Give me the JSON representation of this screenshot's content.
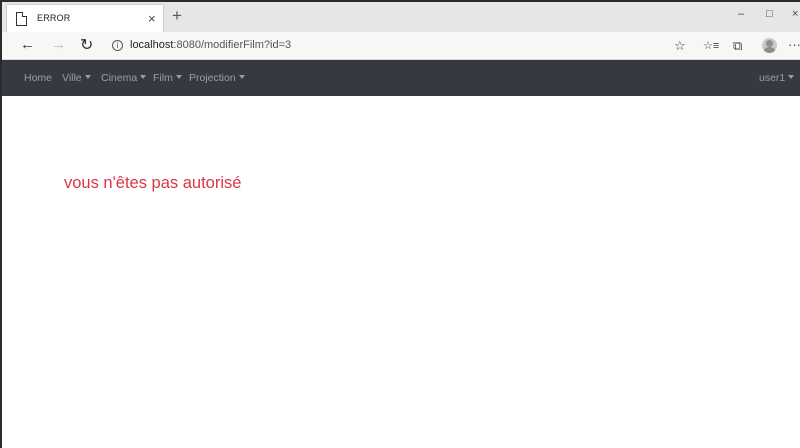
{
  "browser": {
    "tab_title": "ERROR",
    "tab_close": "×",
    "new_tab": "+",
    "back": "←",
    "forward": "→",
    "reload": "↻",
    "info": "i",
    "url_host": "localhost",
    "url_rest": ":8080/modifierFilm?id=3",
    "window_controls": {
      "minimize": "–",
      "restore": "□",
      "close": "×"
    },
    "toolbar_icons": [
      "star-icon",
      "favorites-icon",
      "collections-icon",
      "profile-icon",
      "more-icon"
    ],
    "toolbar_glyphs": {
      "star": "☆",
      "favorites": "☆≡",
      "collections": "⧉",
      "more": "···"
    }
  },
  "navbar": {
    "items": [
      {
        "label": "Home",
        "dropdown": false
      },
      {
        "label": "Ville",
        "dropdown": true
      },
      {
        "label": "Cinema",
        "dropdown": true
      },
      {
        "label": "Film",
        "dropdown": true
      },
      {
        "label": "Projection",
        "dropdown": true
      }
    ],
    "user": {
      "label": "user1",
      "dropdown": true
    },
    "background": "#343a40"
  },
  "main": {
    "error_message": "vous n'êtes pas autorisé",
    "error_color": "#dc3545"
  }
}
